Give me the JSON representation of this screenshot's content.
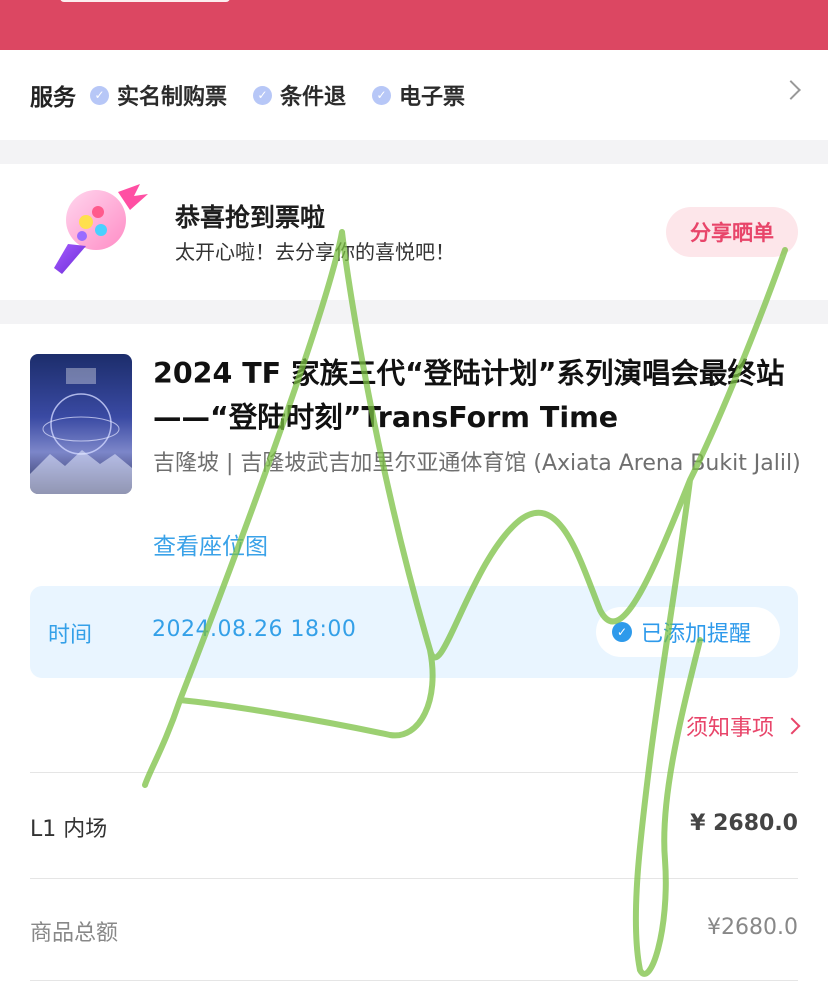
{
  "services": {
    "title": "服务",
    "items": [
      "实名制购票",
      "条件退",
      "电子票"
    ]
  },
  "congrats": {
    "title": "恭喜抢到票啦",
    "subtitle": "太开心啦！去分享你的喜悦吧！",
    "share_label": "分享晒单"
  },
  "event": {
    "title": "2024 TF 家族三代“登陆计划”系列演唱会最终站——“登陆时刻”TransForm Time",
    "venue": "吉隆坡 | 吉隆坡武吉加里尔亚通体育馆 (Axiata Arena Bukit Jalil)",
    "seatmap_label": "查看座位图"
  },
  "time": {
    "label": "时间",
    "value": "2024.08.26 18:00",
    "reminder_label": "已添加提醒"
  },
  "notice_label": "须知事项",
  "ticket": {
    "zone": "L1 内场",
    "price": "¥ 2680.0"
  },
  "total": {
    "label": "商品总额",
    "value": "¥2680.0"
  },
  "colors": {
    "brand_red": "#dc4762",
    "accent_blue": "#34a0e8",
    "pink": "#e8456a",
    "scribble_green": "#7bc043"
  }
}
